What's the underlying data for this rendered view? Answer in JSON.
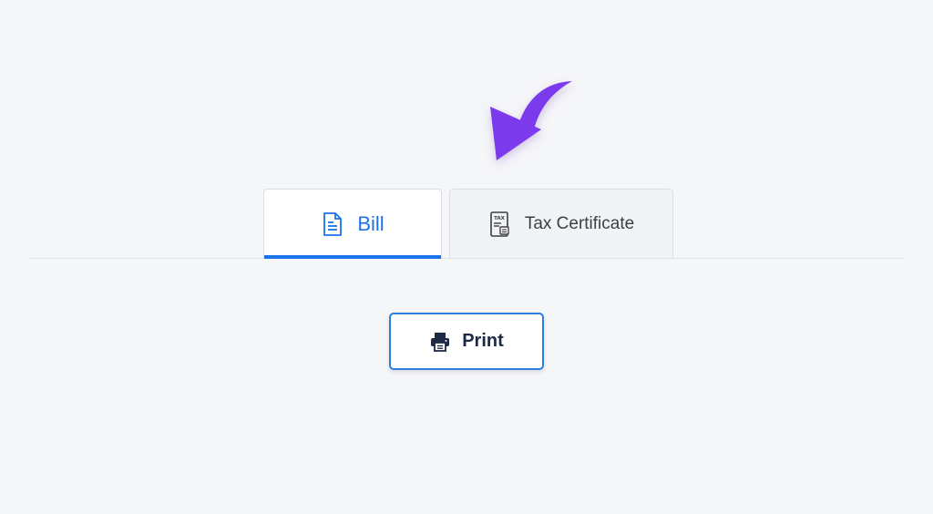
{
  "colors": {
    "background": "#f5f6f8",
    "accent": "#1a73e8",
    "arrow": "#7c3aed",
    "print_text": "#1c2a46"
  },
  "annotation": {
    "icon": "curved-arrow-icon"
  },
  "tabs": [
    {
      "label": "Bill",
      "icon": "document-icon",
      "active": true
    },
    {
      "label": "Tax Certificate",
      "icon": "tax-certificate-icon",
      "active": false
    }
  ],
  "actions": {
    "print_label": "Print",
    "print_icon": "printer-icon"
  }
}
